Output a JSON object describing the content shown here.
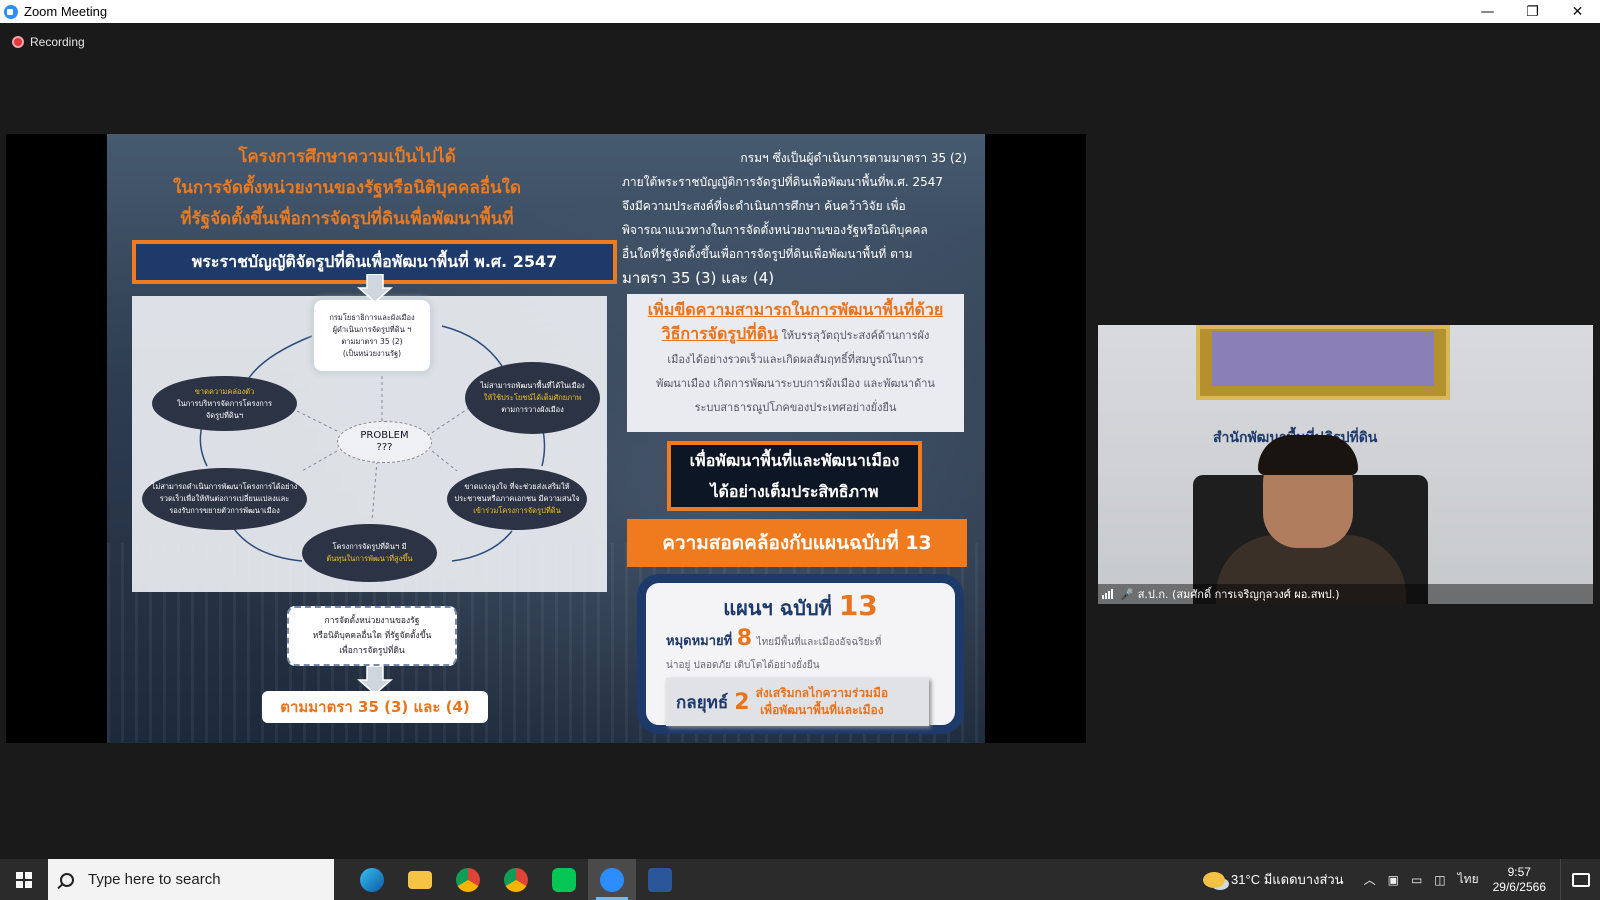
{
  "window": {
    "title": "Zoom Meeting",
    "min": "—",
    "max": "❐",
    "close": "✕"
  },
  "meeting": {
    "recording_label": "Recording"
  },
  "slide": {
    "header": [
      "โครงการศึกษาความเป็นไปได้",
      "ในการจัดตั้งหน่วยงานของรัฐหรือนิติบุคคลอื่นใด",
      "ที่รัฐจัดตั้งขึ้นเพื่อการจัดรูปที่ดินเพื่อพัฒนาพื้นที่"
    ],
    "act_title": "พระราชบัญญัติจัดรูปที่ดินเพื่อพัฒนาพื้นที่ พ.ศ. 2547",
    "diagram": {
      "top_node": [
        "กรมโยธาธิการและผังเมือง",
        "ผู้ดำเนินการจัดรูปที่ดิน ฯ",
        "ตามมาตรา 35 (2)",
        "(เป็นหน่วยงานรัฐ)"
      ],
      "left_node": [
        "ขาดความคล่องตัว",
        "ในการบริหารจัดการโครงการ",
        "จัดรูปที่ดินฯ"
      ],
      "right_node": [
        "ไม่สามารถพัฒนาพื้นที่ได้ในเมือง",
        "ให้ใช้ประโยชน์ได้เต็มศักยภาพ",
        "ตามการวางผังเมือง"
      ],
      "problem": [
        "PROBLEM",
        "???"
      ],
      "lower_left_node": [
        "ไม่สามารถดำเนินการพัฒนาโครงการได้อย่าง",
        "รวดเร็วเพื่อให้ทันต่อการเปลี่ยนแปลงและ",
        "รองรับการขยายตัวการพัฒนาเมือง"
      ],
      "lower_right_node": [
        "ขาดแรงจูงใจ ที่จะช่วยส่งเสริมให้",
        "ประชาชนหรือภาคเอกชน มีความสนใจ",
        "เข้าร่วมโครงการจัดรูปที่ดิน"
      ],
      "bottom_node": [
        "โครงการจัดรูปที่ดินฯ มี",
        "ต้นทุนในการพัฒนาที่สูงขึ้น"
      ]
    },
    "down_box": [
      "การจัดตั้งหน่วยงานของรัฐ",
      "หรือนิติบุคคลอื่นใด ที่รัฐจัดตั้งขึ้น",
      "เพื่อการจัดรูปที่ดิน"
    ],
    "section_box": "ตามมาตรา 35 (3) และ (4)",
    "right_text": [
      "กรมฯ ซึ่งเป็นผู้ดำเนินการตามมาตรา 35 (2)",
      "ภายใต้พระราชบัญญัติการจัดรูปที่ดินเพื่อพัฒนาพื้นที่พ.ศ. 2547",
      "จึงมีความประสงค์ที่จะดำเนินการศึกษา ค้นคว้าวิจัย เพื่อ",
      "พิจารณาแนวทางในการจัดตั้งหน่วยงานของรัฐหรือนิติบุคคล",
      "อื่นใดที่รัฐจัดตั้งขึ้นเพื่อการจัดรูปที่ดินเพื่อพัฒนาพื้นที่ ตาม",
      "มาตรา 35 (3) และ (4)"
    ],
    "enhance": {
      "headline_1": "เพิ่มขีดความสามารถในการพัฒนาพื้นที่ด้วย",
      "headline_2": "วิธีการจัดรูปที่ดิน",
      "body_1": "ให้บรรลุวัตถุประสงค์ด้านการผัง",
      "body_2": "เมืองได้อย่างรวดเร็วและเกิดผลสัมฤทธิ์ที่สมบูรณ์ในการ",
      "body_3": "พัฒนาเมือง เกิดการพัฒนาระบบการผังเมือง และพัฒนาด้าน",
      "body_4": "ระบบสาธารณูปโภคของประเทศอย่างยั่งยืน"
    },
    "goal": [
      "เพื่อพัฒนาพื้นที่และพัฒนาเมือง",
      "ได้อย่างเต็มประสิทธิภาพ"
    ],
    "plan_bar": "ความสอดคล้องกับแผนฉบับที่ 13",
    "plan": {
      "title_prefix": "แผนฯ ฉบับที่",
      "title_num": "13",
      "milestone_label": "หมุดหมายที่",
      "milestone_num": "8",
      "milestone_desc_1": "ไทยมีพื้นที่และเมืองอัจฉริยะที่",
      "milestone_desc_2": "น่าอยู่ ปลอดภัย เติบโตได้อย่างยั่งยืน",
      "strategy_label": "กลยุทธ์",
      "strategy_num": "2",
      "strategy_desc_1": "ส่งเสริมกลไกความร่วมมือ",
      "strategy_desc_2": "เพื่อพัฒนาพื้นที่และเมือง"
    }
  },
  "video": {
    "sign_text": "สำนักพัฒนาพื้นที่ปฏิรูปที่ดิน",
    "participant_name": "ส.ป.ก. (สมศักดิ์ การเจริญกุลวงศ์ ผอ.สพป.)"
  },
  "taskbar": {
    "search_placeholder": "Type here to search",
    "apps": [
      "edge-icon",
      "file-explorer-icon",
      "chrome-icon",
      "chrome-profile-icon",
      "line-icon",
      "zoom-icon",
      "word-icon"
    ],
    "weather_temp": "31°C",
    "weather_desc": "มีแดดบางส่วน",
    "lang": "ไทย",
    "time": "9:57",
    "date": "29/6/2566"
  }
}
